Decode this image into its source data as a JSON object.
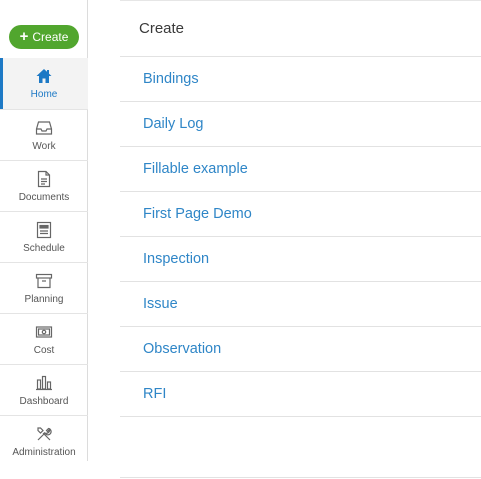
{
  "sidebar": {
    "create_label": "Create",
    "items": [
      {
        "label": "Home",
        "icon": "home-icon",
        "active": true
      },
      {
        "label": "Work",
        "icon": "inbox-icon"
      },
      {
        "label": "Documents",
        "icon": "document-icon"
      },
      {
        "label": "Schedule",
        "icon": "schedule-icon"
      },
      {
        "label": "Planning",
        "icon": "archive-box-icon"
      },
      {
        "label": "Cost",
        "icon": "banknote-icon"
      },
      {
        "label": "Dashboard",
        "icon": "bar-chart-icon"
      },
      {
        "label": "Administration",
        "icon": "tools-icon"
      }
    ]
  },
  "main": {
    "title": "Create",
    "items": [
      "Bindings",
      "Daily Log",
      "Fillable example",
      "First Page Demo",
      "Inspection",
      "Issue",
      "Observation",
      "RFI"
    ]
  },
  "colors": {
    "accent": "#1d79c5",
    "create_button": "#51a62e",
    "link": "#2f86c7"
  }
}
